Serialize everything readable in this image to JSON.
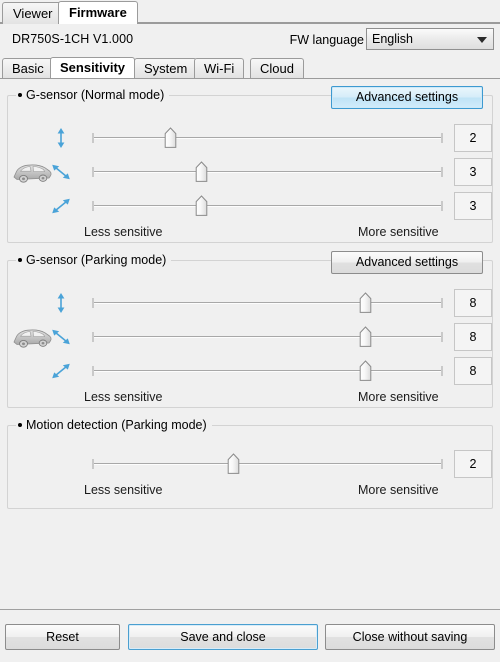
{
  "window_tabs": [
    {
      "label": "Viewer",
      "active": false
    },
    {
      "label": "Firmware",
      "active": true
    }
  ],
  "info": {
    "model": "DR750S-1CH   V1.000",
    "fw_language_label": "FW language",
    "fw_language_value": "English",
    "chevron_icon": "chevron-down-icon"
  },
  "section_tabs": [
    {
      "label": "Basic",
      "active": false
    },
    {
      "label": "Sensitivity",
      "active": true
    },
    {
      "label": "System",
      "active": false
    },
    {
      "label": "Wi-Fi",
      "active": false
    },
    {
      "label": "Cloud",
      "active": false
    }
  ],
  "hints": {
    "less": "Less sensitive",
    "more": "More sensitive"
  },
  "advanced_settings_label": "Advanced settings",
  "groups": [
    {
      "title": "G-sensor (Normal mode)",
      "has_advanced": true,
      "advanced_highlighted": true,
      "has_car_icon": true,
      "sliders": [
        {
          "axis_icon": "arrow-vertical-icon",
          "value": "2",
          "percent": 22
        },
        {
          "axis_icon": "arrow-diagonal-nw-icon",
          "value": "3",
          "percent": 31
        },
        {
          "axis_icon": "arrow-diagonal-ne-icon",
          "value": "3",
          "percent": 31
        }
      ]
    },
    {
      "title": "G-sensor (Parking mode)",
      "has_advanced": true,
      "advanced_highlighted": false,
      "has_car_icon": true,
      "sliders": [
        {
          "axis_icon": "arrow-vertical-icon",
          "value": "8",
          "percent": 78
        },
        {
          "axis_icon": "arrow-diagonal-nw-icon",
          "value": "8",
          "percent": 78
        },
        {
          "axis_icon": "arrow-diagonal-ne-icon",
          "value": "8",
          "percent": 78
        }
      ]
    },
    {
      "title": "Motion detection (Parking mode)",
      "has_advanced": false,
      "advanced_highlighted": false,
      "has_car_icon": false,
      "sliders": [
        {
          "axis_icon": "",
          "value": "2",
          "percent": 40
        }
      ]
    }
  ],
  "footer": {
    "reset": "Reset",
    "save_and_close": "Save and close",
    "close_without_saving": "Close without saving"
  },
  "colors": {
    "accent": "#3d9ad1",
    "panel_bg": "#f0f0f0",
    "arrow_blue": "#4aa3d8"
  }
}
